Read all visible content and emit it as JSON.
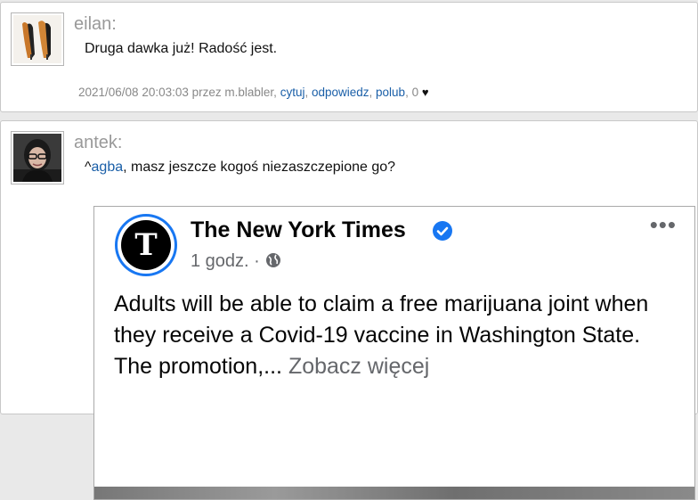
{
  "posts": [
    {
      "author": "eilan:",
      "body": "Druga dawka już! Radość jest.",
      "meta": {
        "timestamp": "2021/06/08 20:03:03",
        "by_prefix": " przez ",
        "by_user": "m.blabler",
        "quote": "cytuj",
        "reply": "odpowiedz",
        "like": "polub",
        "likes_count": "0",
        "heart": "♥"
      }
    },
    {
      "author": "antek:",
      "body_prefix": "^",
      "mention": "agba",
      "body_rest": ", masz jeszcze kogoś niezaszczepione go?"
    }
  ],
  "embed": {
    "logo_letter": "T",
    "page_name": "The New York Times",
    "post_time": "1 godz. · ",
    "more": "•••",
    "status_text": "Adults will be able to claim a free marijuana joint when they receive a Covid-19 vaccine in Washington State. The promotion,... ",
    "see_more": "Zobacz więcej",
    "verified_color": "#1877f2"
  },
  "colors": {
    "link": "#1a5fa8",
    "author": "#999999",
    "meta": "#888888"
  }
}
